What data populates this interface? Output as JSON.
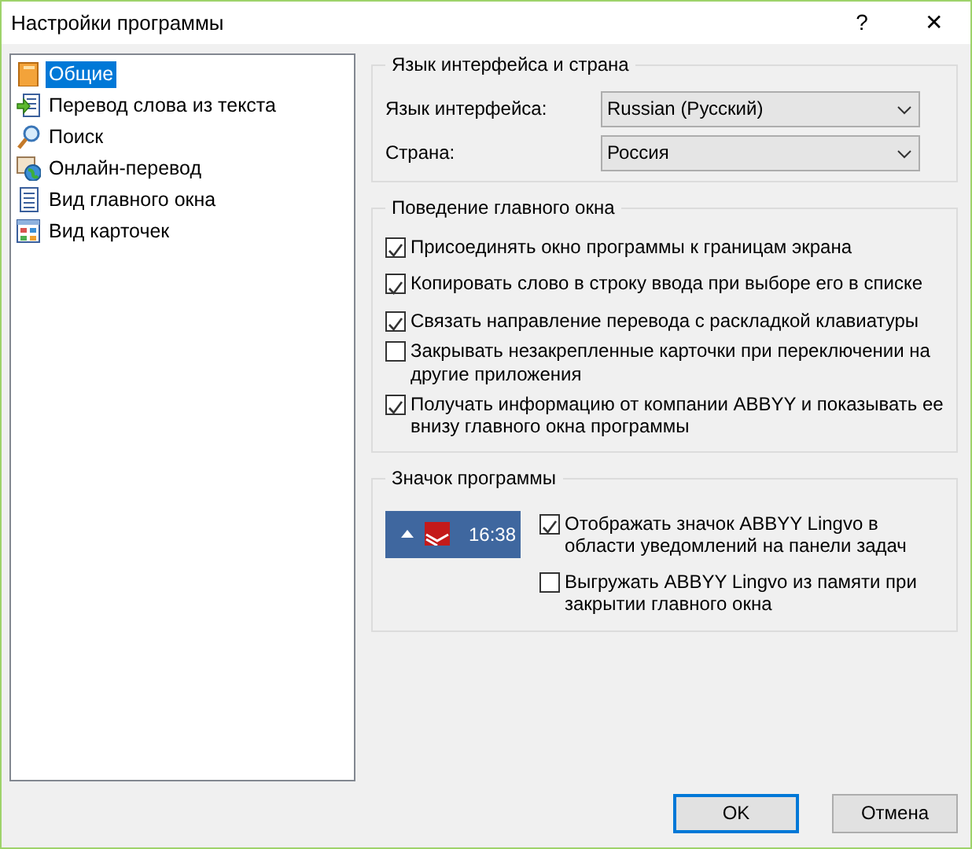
{
  "window": {
    "title": "Настройки программы",
    "help": "?",
    "close": "✕"
  },
  "tree": [
    {
      "label": "Общие",
      "selected": true
    },
    {
      "label": "Перевод слова из текста",
      "selected": false
    },
    {
      "label": "Поиск",
      "selected": false
    },
    {
      "label": "Онлайн-перевод",
      "selected": false
    },
    {
      "label": "Вид главного окна",
      "selected": false
    },
    {
      "label": "Вид карточек",
      "selected": false
    }
  ],
  "language_group": {
    "title": "Язык интерфейса и страна",
    "fields": [
      {
        "label": "Язык интерфейса:",
        "value": "Russian (Русский)"
      },
      {
        "label": "Страна:",
        "value": "Россия"
      }
    ]
  },
  "behavior_group": {
    "title": "Поведение главного окна",
    "options": [
      {
        "label": "Присоединять окно программы к границам экрана",
        "checked": true
      },
      {
        "label": "Копировать слово в строку ввода при выборе его в списке",
        "checked": true
      },
      {
        "label": "Связать направление перевода с раскладкой клавиатуры",
        "checked": true
      },
      {
        "label": "Закрывать незакрепленные карточки при переключении на другие приложения",
        "checked": false
      },
      {
        "label": "Получать информацию от компании ABBYY и показывать ее внизу главного окна программы",
        "checked": true
      }
    ]
  },
  "icon_group": {
    "title": "Значок программы",
    "tray_time": "16:38",
    "options": [
      {
        "label": "Отображать значок ABBYY Lingvo в области уведомлений на панели задач",
        "checked": true
      },
      {
        "label": "Выгружать ABBYY Lingvo из памяти при закрытии главного окна",
        "checked": false
      }
    ]
  },
  "buttons": [
    {
      "label": "OK",
      "default": true
    },
    {
      "label": "Отмена",
      "default": false
    }
  ]
}
